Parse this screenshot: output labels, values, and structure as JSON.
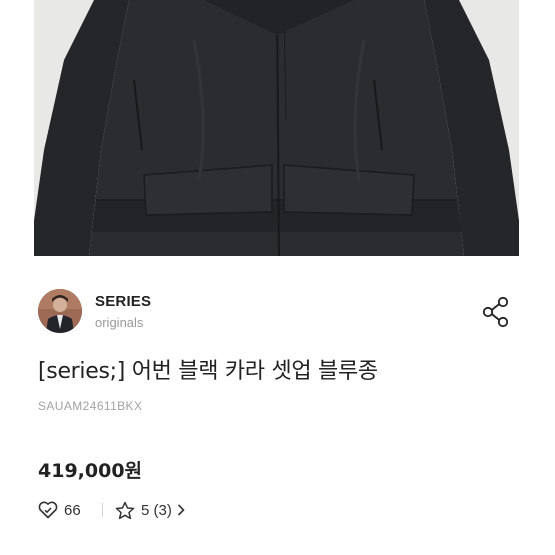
{
  "seller": {
    "name": "SERIES",
    "subtitle": "originals",
    "avatar_icon": "seller-avatar"
  },
  "product": {
    "title": "[series;] 어번 블랙 카라 셋업 블루종",
    "sku": "SAUAM24611BKX",
    "price": "419,000원"
  },
  "stats": {
    "likes": "66",
    "rating": "5 (3)",
    "like_icon": "heart-icon",
    "rating_icon": "star-icon",
    "more_icon": "chevron-right-icon"
  },
  "actions": {
    "share_icon": "share-icon"
  },
  "colors": {
    "text": "#222222",
    "muted": "#9a9a9a",
    "photo_bg": "#e8e8e6",
    "jacket": "#2a2b2e"
  }
}
